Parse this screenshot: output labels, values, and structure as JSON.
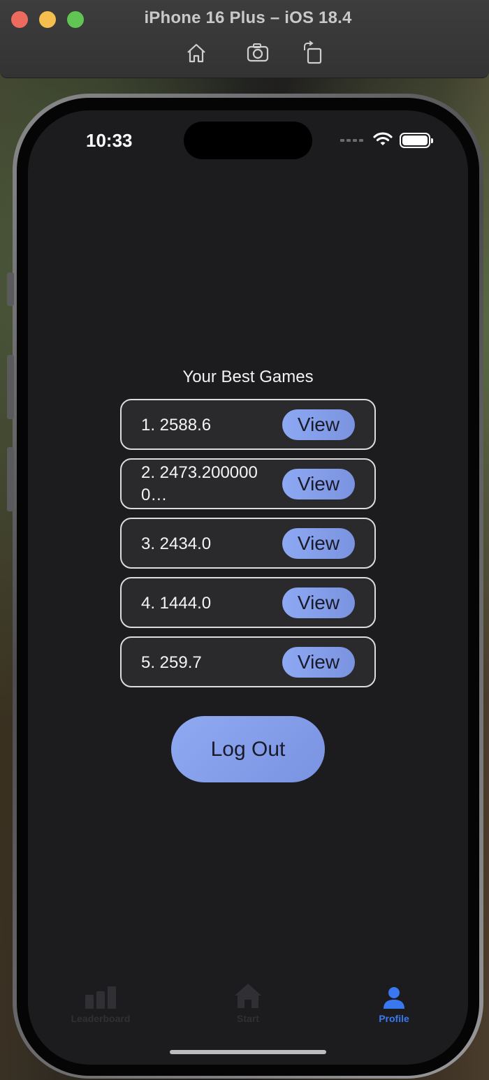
{
  "simulator": {
    "title": "iPhone 16 Plus – iOS 18.4",
    "tools": [
      "home-icon",
      "screenshot-icon",
      "rotate-icon"
    ]
  },
  "status_bar": {
    "time": "10:33",
    "icons": [
      "cellular-dots-icon",
      "wifi-icon",
      "battery-icon"
    ]
  },
  "best_games": {
    "title": "Your Best Games",
    "entries": [
      {
        "label": "1. 2588.6",
        "button": "View"
      },
      {
        "label": "2. 2473.2000000…",
        "button": "View"
      },
      {
        "label": "3. 2434.0",
        "button": "View"
      },
      {
        "label": "4. 1444.0",
        "button": "View"
      },
      {
        "label": "5. 259.7",
        "button": "View"
      }
    ]
  },
  "logout_label": "Log Out",
  "tab_bar": {
    "items": [
      {
        "label": "Leaderboard",
        "icon": "chart-bars-icon",
        "active": false
      },
      {
        "label": "Start",
        "icon": "house-icon",
        "active": false
      },
      {
        "label": "Profile",
        "icon": "person-icon",
        "active": true
      }
    ]
  },
  "colors": {
    "accent_blue": "#3a78f2",
    "button_gradient": "#8ea9f3",
    "screen_bg": "#1c1c1e"
  }
}
